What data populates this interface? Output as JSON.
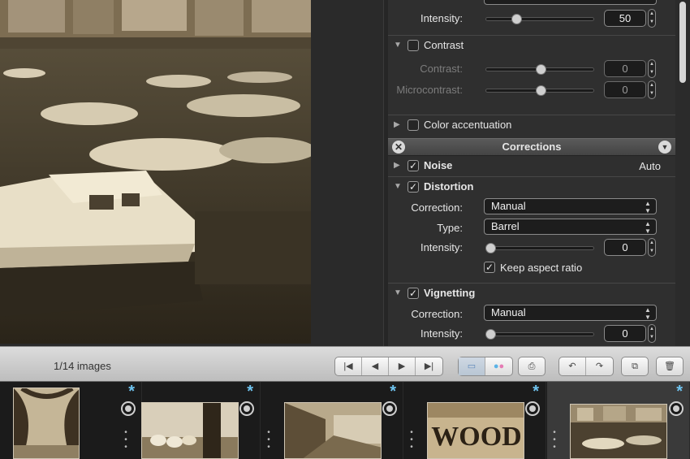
{
  "inspector": {
    "top_row": {
      "label": "Intensity:",
      "value": "50"
    },
    "contrast": {
      "title": "Contrast",
      "rows": [
        {
          "label": "Contrast:",
          "value": "0"
        },
        {
          "label": "Microcontrast:",
          "value": "0"
        }
      ]
    },
    "color_accentuation": {
      "title": "Color accentuation"
    },
    "corrections_title": "Corrections",
    "noise": {
      "title": "Noise",
      "value": "Auto"
    },
    "distortion": {
      "title": "Distortion",
      "correction_label": "Correction:",
      "correction_value": "Manual",
      "type_label": "Type:",
      "type_value": "Barrel",
      "intensity_label": "Intensity:",
      "intensity_value": "0",
      "keep_aspect_label": "Keep aspect ratio"
    },
    "vignetting": {
      "title": "Vignetting",
      "correction_label": "Correction:",
      "correction_value": "Manual",
      "intensity_label": "Intensity:",
      "intensity_value": "0"
    }
  },
  "toolbar": {
    "count_label": "1/14 images"
  },
  "filmstrip": {
    "items": [
      {
        "name": "tree-thumbnail",
        "starred": true
      },
      {
        "name": "sheep-thumbnail",
        "starred": true
      },
      {
        "name": "street-thumbnail",
        "starred": true
      },
      {
        "name": "wood-thumbnail",
        "starred": true,
        "text": "WOOD"
      },
      {
        "name": "harbour-thumbnail",
        "starred": true,
        "selected": true
      }
    ]
  },
  "colors": {
    "accent_star": "#6fc4f0",
    "sepia": "#6b5a40"
  }
}
